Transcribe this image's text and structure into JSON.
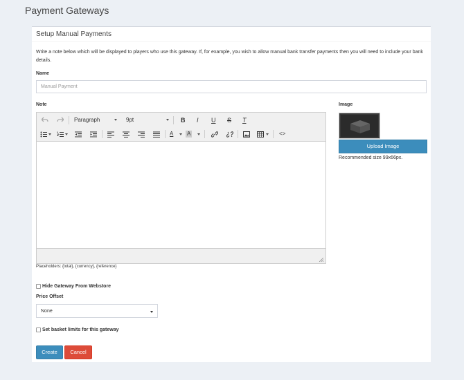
{
  "page": {
    "title": "Payment Gateways"
  },
  "box": {
    "title": "Setup Manual Payments",
    "description": "Write a note below which will be displayed to players who use this gateway. If, for example, you wish to allow manual bank transfer payments then you will need to include your bank details."
  },
  "name_field": {
    "label": "Name",
    "placeholder": "Manual Payment"
  },
  "note": {
    "label": "Note",
    "toolbar": {
      "format_select": "Paragraph",
      "size_select": "9pt",
      "bold": "B",
      "italic": "I",
      "underline": "U",
      "strike": "S",
      "clear": "T",
      "text_color": "A",
      "bg_color": "A",
      "code": "<>"
    },
    "placeholders": "Placeholders: {total}, {currency}, {reference}"
  },
  "image": {
    "label": "Image",
    "upload_button": "Upload Image",
    "recommended": "Recommended size 99x66px."
  },
  "hide_gateway": {
    "label": "Hide Gateway From Webstore",
    "checked": false
  },
  "price_offset": {
    "label": "Price Offset",
    "selected": "None"
  },
  "basket_limits": {
    "label": "Set basket limits for this gateway",
    "checked": false
  },
  "actions": {
    "create": "Create",
    "cancel": "Cancel"
  },
  "colors": {
    "primary": "#3c8dbc",
    "danger": "#dd4b39",
    "background": "#ecf0f5"
  }
}
